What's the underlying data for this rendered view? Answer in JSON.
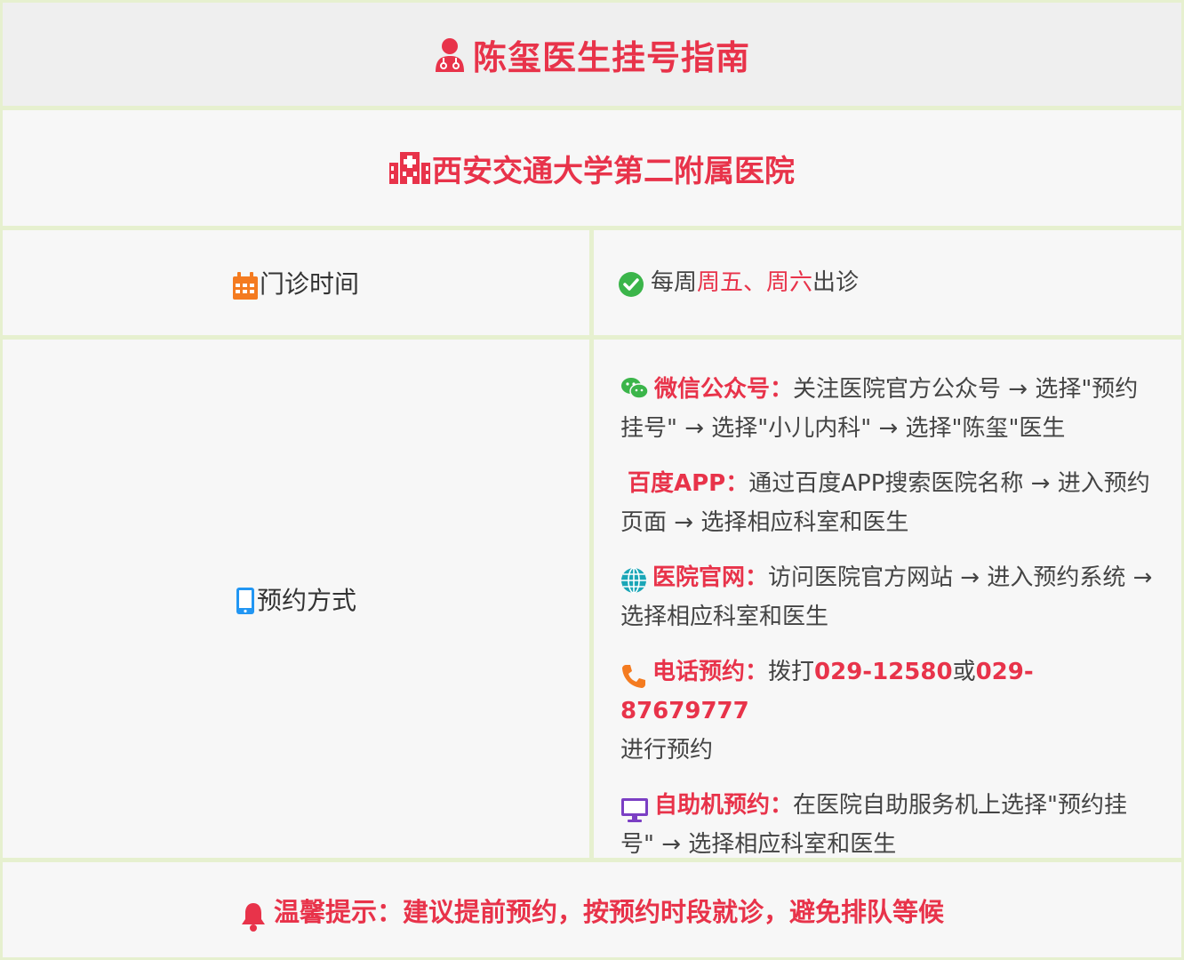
{
  "header": {
    "title": "陈玺医生挂号指南",
    "icon": "doctor-icon"
  },
  "hospital": {
    "name": "西安交通大学第二附属医院",
    "icon": "hospital-icon"
  },
  "schedule": {
    "label": "门诊时间",
    "icon": "calendar-icon",
    "prefix": "每周",
    "days": "周五、周六",
    "suffix": "出诊"
  },
  "booking": {
    "label": "预约方式",
    "icon": "mobile-icon",
    "methods": [
      {
        "icon": "wechat-icon",
        "key": "微信公众号：",
        "text": "关注医院官方公众号 → 选择\"预约挂号\" → 选择\"小儿内科\" → 选择\"陈玺\"医生"
      },
      {
        "icon": "",
        "key": "百度APP：",
        "text": "通过百度APP搜索医院名称 → 进入预约页面 → 选择相应科室和医生"
      },
      {
        "icon": "globe-icon",
        "key": "医院官网：",
        "text": "访问医院官方网站 → 进入预约系统 → 选择相应科室和医生"
      },
      {
        "icon": "phone-icon",
        "key": "电话预约：",
        "pre": "拨打",
        "phone1": "029-12580",
        "mid": "或",
        "phone2": "029-87679777",
        "post": "进行预约"
      },
      {
        "icon": "desktop-icon",
        "key": "自助机预约：",
        "text": "在医院自助服务机上选择\"预约挂号\" → 选择相应科室和医生"
      }
    ]
  },
  "footer": {
    "tip": "温馨提示：建议提前预约，按预约时段就诊，避免排队等候",
    "icon": "bell-icon"
  },
  "colors": {
    "accent": "#e8334a",
    "border": "#e6f0cf",
    "check": "#3bb54a",
    "calendar": "#f47b20",
    "mobile": "#2196f3",
    "phone": "#f47b20",
    "desktop": "#7b3fc4"
  }
}
